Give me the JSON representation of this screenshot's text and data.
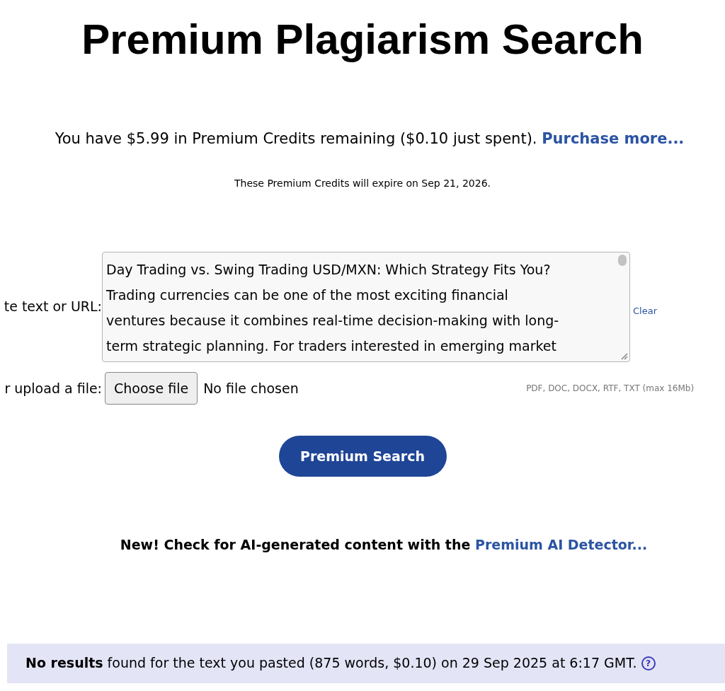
{
  "title": "Premium Plagiarism Search",
  "credits": {
    "text": "You have $5.99 in Premium Credits remaining ($0.10 just spent).",
    "link": "Purchase more..."
  },
  "expiry": "These Premium Credits will expire on Sep 21, 2026.",
  "text_input": {
    "label": "te text or URL:",
    "value": "Day Trading vs. Swing Trading USD/MXN: Which Strategy Fits You?\nTrading currencies can be one of the most exciting financial\nventures because it combines real-time decision-making with long-\nterm strategic planning. For traders interested in emerging market",
    "clear": "Clear"
  },
  "file_input": {
    "label": "r upload a file:",
    "button": "Choose file",
    "status": "No file chosen",
    "hint": "PDF, DOC, DOCX, RTF, TXT (max 16Mb)"
  },
  "search_button": "Premium Search",
  "ai_notice": {
    "text": "New! Check for AI-generated content with the",
    "link": "Premium AI Detector..."
  },
  "result": {
    "text": "**No results** found for the text you pasted (875 words, $0.10) on 29 Sep 2025 at 6:17 GMT.",
    "help": "?"
  }
}
